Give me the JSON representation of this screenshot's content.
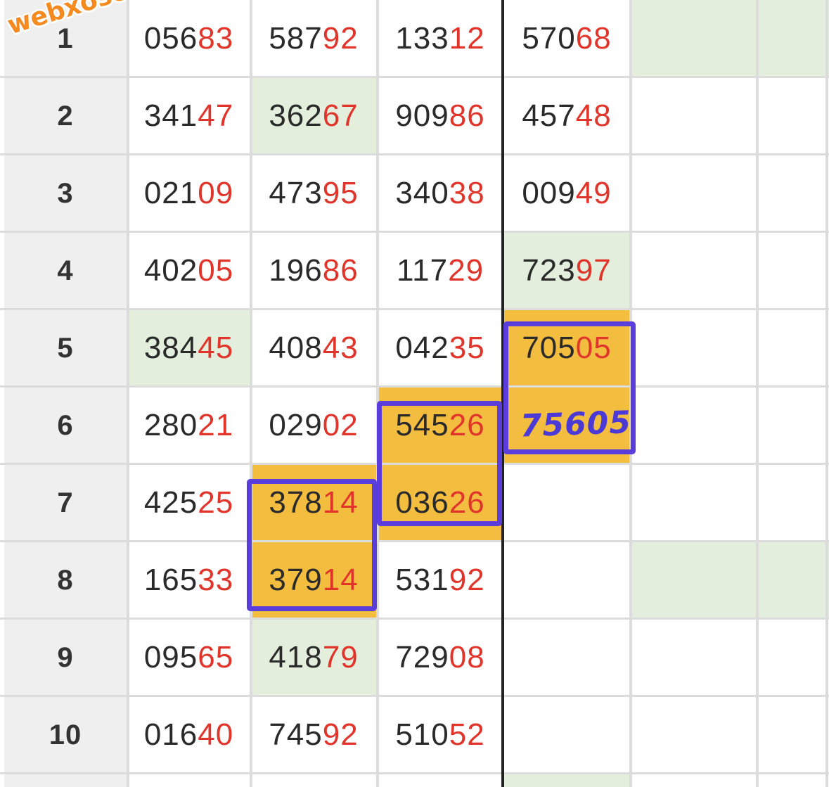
{
  "watermark": "webxoso.net",
  "handwritten_value": "75605",
  "rows": [
    {
      "label": "1",
      "cells": [
        {
          "a": "056",
          "b": "83"
        },
        {
          "a": "587",
          "b": "92"
        },
        {
          "a": "133",
          "b": "12"
        },
        {
          "a": "570",
          "b": "68"
        }
      ]
    },
    {
      "label": "2",
      "cells": [
        {
          "a": "341",
          "b": "47"
        },
        {
          "a": "362",
          "b": "67"
        },
        {
          "a": "909",
          "b": "86"
        },
        {
          "a": "457",
          "b": "48"
        }
      ]
    },
    {
      "label": "3",
      "cells": [
        {
          "a": "021",
          "b": "09"
        },
        {
          "a": "473",
          "b": "95"
        },
        {
          "a": "340",
          "b": "38"
        },
        {
          "a": "009",
          "b": "49"
        }
      ]
    },
    {
      "label": "4",
      "cells": [
        {
          "a": "402",
          "b": "05"
        },
        {
          "a": "196",
          "b": "86"
        },
        {
          "a": "117",
          "b": "29"
        },
        {
          "a": "723",
          "b": "97"
        }
      ]
    },
    {
      "label": "5",
      "cells": [
        {
          "a": "384",
          "b": "45"
        },
        {
          "a": "408",
          "b": "43"
        },
        {
          "a": "042",
          "b": "35"
        },
        {
          "a": "705",
          "b": "05"
        }
      ]
    },
    {
      "label": "6",
      "cells": [
        {
          "a": "280",
          "b": "21"
        },
        {
          "a": "029",
          "b": "02"
        },
        {
          "a": "545",
          "b": "26"
        },
        {
          "a": "",
          "b": ""
        }
      ]
    },
    {
      "label": "7",
      "cells": [
        {
          "a": "425",
          "b": "25"
        },
        {
          "a": "378",
          "b": "14"
        },
        {
          "a": "036",
          "b": "26"
        },
        {
          "a": "",
          "b": ""
        }
      ]
    },
    {
      "label": "8",
      "cells": [
        {
          "a": "165",
          "b": "33"
        },
        {
          "a": "379",
          "b": "14"
        },
        {
          "a": "531",
          "b": "92"
        },
        {
          "a": "",
          "b": ""
        }
      ]
    },
    {
      "label": "9",
      "cells": [
        {
          "a": "095",
          "b": "65"
        },
        {
          "a": "418",
          "b": "79"
        },
        {
          "a": "729",
          "b": "08"
        },
        {
          "a": "",
          "b": ""
        }
      ]
    },
    {
      "label": "10",
      "cells": [
        {
          "a": "016",
          "b": "40"
        },
        {
          "a": "745",
          "b": "92"
        },
        {
          "a": "510",
          "b": "52"
        },
        {
          "a": "",
          "b": ""
        }
      ]
    }
  ],
  "colors": {
    "index_bg": "#efefef",
    "green": "#e3efdc",
    "orange": "#f3bd40",
    "red_digits": "#e1352c",
    "box_border": "#5b3ddb"
  }
}
